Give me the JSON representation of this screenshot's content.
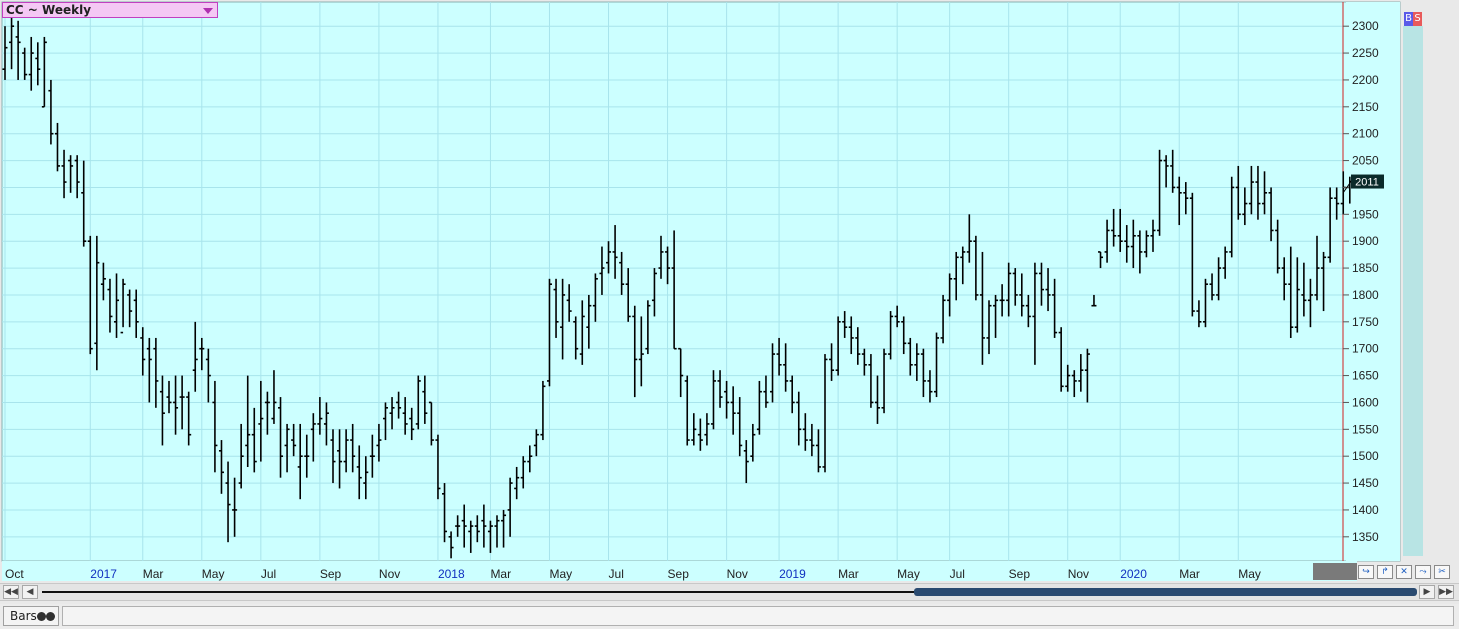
{
  "symbol": {
    "label": "CC ~ Weekly"
  },
  "price_badges": {
    "buy": "B",
    "sell": "S"
  },
  "status_bar": {
    "bars_tab_label": "Bars"
  },
  "scrollbar": {
    "left_end": "◀◀",
    "left": "◀",
    "right": "▶",
    "right_end": "▶▶"
  },
  "toolbar": {
    "buttons": [
      "↪",
      "↱",
      "✕",
      "⤳",
      "✂"
    ]
  },
  "colors": {
    "plot_bg": "#ccffff",
    "grid": "#a8e4ec",
    "bar": "#000000",
    "time_marker": "#d02020",
    "last_price_bg": "#0a2a2a"
  },
  "chart_data": {
    "type": "ohlc",
    "ylim": [
      1305,
      2345
    ],
    "yticks": [
      1350,
      1400,
      1450,
      1500,
      1550,
      1600,
      1650,
      1700,
      1750,
      1800,
      1850,
      1900,
      1950,
      2000,
      2050,
      2100,
      2150,
      2200,
      2250,
      2300
    ],
    "ytick_labels": [
      "1350",
      "1400",
      "1450",
      "1500",
      "1550",
      "1600",
      "1650",
      "1700",
      "1750",
      "1800",
      "1850",
      "1900",
      "1950",
      "",
      "2050",
      "2100",
      "2150",
      "2200",
      "2250",
      "2300"
    ],
    "last_price": "2011",
    "start_week": "2016-10-03",
    "x_labels": [
      {
        "label": "Oct",
        "week": 0,
        "year": false
      },
      {
        "label": "2017",
        "week": 13,
        "year": true
      },
      {
        "label": "Mar",
        "week": 21,
        "year": false
      },
      {
        "label": "May",
        "week": 30,
        "year": false
      },
      {
        "label": "Jul",
        "week": 39,
        "year": false
      },
      {
        "label": "Sep",
        "week": 48,
        "year": false
      },
      {
        "label": "Nov",
        "week": 57,
        "year": false
      },
      {
        "label": "2018",
        "week": 66,
        "year": true
      },
      {
        "label": "Mar",
        "week": 74,
        "year": false
      },
      {
        "label": "May",
        "week": 83,
        "year": false
      },
      {
        "label": "Jul",
        "week": 92,
        "year": false
      },
      {
        "label": "Sep",
        "week": 101,
        "year": false
      },
      {
        "label": "Nov",
        "week": 110,
        "year": false
      },
      {
        "label": "2019",
        "week": 118,
        "year": true
      },
      {
        "label": "Mar",
        "week": 127,
        "year": false
      },
      {
        "label": "May",
        "week": 136,
        "year": false
      },
      {
        "label": "Jul",
        "week": 144,
        "year": false
      },
      {
        "label": "Sep",
        "week": 153,
        "year": false
      },
      {
        "label": "Nov",
        "week": 162,
        "year": false
      },
      {
        "label": "2020",
        "week": 170,
        "year": true
      },
      {
        "label": "Mar",
        "week": 179,
        "year": false
      },
      {
        "label": "May",
        "week": 188,
        "year": false
      }
    ],
    "ohlc": [
      [
        2220,
        2300,
        2200,
        2260
      ],
      [
        2270,
        2320,
        2220,
        2300
      ],
      [
        2280,
        2310,
        2200,
        2270
      ],
      [
        2250,
        2260,
        2200,
        2210
      ],
      [
        2210,
        2280,
        2180,
        2250
      ],
      [
        2240,
        2270,
        2190,
        2220
      ],
      [
        2150,
        2280,
        2150,
        2270
      ],
      [
        2180,
        2200,
        2080,
        2100
      ],
      [
        2100,
        2120,
        2030,
        2040
      ],
      [
        2040,
        2070,
        1980,
        2010
      ],
      [
        2050,
        2060,
        1990,
        2040
      ],
      [
        2050,
        2060,
        1980,
        2010
      ],
      [
        1990,
        2050,
        1890,
        1900
      ],
      [
        1900,
        1910,
        1690,
        1700
      ],
      [
        1710,
        1910,
        1660,
        1860
      ],
      [
        1820,
        1860,
        1790,
        1830
      ],
      [
        1810,
        1830,
        1730,
        1760
      ],
      [
        1750,
        1840,
        1720,
        1790
      ],
      [
        1730,
        1830,
        1740,
        1820
      ],
      [
        1800,
        1810,
        1740,
        1770
      ],
      [
        1790,
        1810,
        1720,
        1750
      ],
      [
        1720,
        1740,
        1650,
        1680
      ],
      [
        1700,
        1720,
        1600,
        1680
      ],
      [
        1700,
        1720,
        1590,
        1640
      ],
      [
        1620,
        1650,
        1520,
        1580
      ],
      [
        1610,
        1640,
        1580,
        1600
      ],
      [
        1600,
        1650,
        1540,
        1590
      ],
      [
        1610,
        1650,
        1550,
        1610
      ],
      [
        1610,
        1620,
        1520,
        1540
      ],
      [
        1660,
        1750,
        1620,
        1680
      ],
      [
        1700,
        1720,
        1660,
        1700
      ],
      [
        1680,
        1700,
        1600,
        1650
      ],
      [
        1600,
        1640,
        1470,
        1520
      ],
      [
        1510,
        1530,
        1430,
        1470
      ],
      [
        1450,
        1490,
        1340,
        1410
      ],
      [
        1400,
        1460,
        1350,
        1400
      ],
      [
        1450,
        1560,
        1440,
        1500
      ],
      [
        1520,
        1650,
        1480,
        1540
      ],
      [
        1540,
        1590,
        1470,
        1490
      ],
      [
        1560,
        1640,
        1490,
        1570
      ],
      [
        1600,
        1620,
        1540,
        1600
      ],
      [
        1570,
        1660,
        1560,
        1600
      ],
      [
        1590,
        1610,
        1460,
        1500
      ],
      [
        1520,
        1560,
        1470,
        1550
      ],
      [
        1530,
        1560,
        1500,
        1520
      ],
      [
        1480,
        1560,
        1420,
        1500
      ],
      [
        1500,
        1540,
        1460,
        1500
      ],
      [
        1550,
        1580,
        1490,
        1560
      ],
      [
        1560,
        1610,
        1540,
        1570
      ],
      [
        1560,
        1600,
        1520,
        1580
      ],
      [
        1530,
        1550,
        1450,
        1490
      ],
      [
        1510,
        1550,
        1440,
        1490
      ],
      [
        1490,
        1550,
        1470,
        1530
      ],
      [
        1530,
        1560,
        1470,
        1500
      ],
      [
        1480,
        1520,
        1420,
        1460
      ],
      [
        1450,
        1500,
        1420,
        1470
      ],
      [
        1500,
        1540,
        1460,
        1500
      ],
      [
        1520,
        1560,
        1490,
        1530
      ],
      [
        1570,
        1600,
        1530,
        1590
      ],
      [
        1580,
        1610,
        1550,
        1590
      ],
      [
        1600,
        1620,
        1570,
        1590
      ],
      [
        1580,
        1610,
        1540,
        1560
      ],
      [
        1570,
        1590,
        1530,
        1550
      ],
      [
        1560,
        1650,
        1550,
        1640
      ],
      [
        1620,
        1650,
        1560,
        1580
      ],
      [
        1600,
        1600,
        1520,
        1530
      ],
      [
        1530,
        1540,
        1420,
        1440
      ],
      [
        1430,
        1450,
        1340,
        1360
      ],
      [
        1350,
        1360,
        1310,
        1330
      ],
      [
        1370,
        1390,
        1350,
        1370
      ],
      [
        1380,
        1410,
        1330,
        1370
      ],
      [
        1360,
        1380,
        1320,
        1370
      ],
      [
        1370,
        1390,
        1340,
        1360
      ],
      [
        1380,
        1410,
        1330,
        1370
      ],
      [
        1360,
        1380,
        1320,
        1370
      ],
      [
        1370,
        1390,
        1330,
        1380
      ],
      [
        1380,
        1400,
        1330,
        1390
      ],
      [
        1400,
        1460,
        1350,
        1450
      ],
      [
        1440,
        1480,
        1420,
        1460
      ],
      [
        1460,
        1500,
        1440,
        1490
      ],
      [
        1490,
        1520,
        1470,
        1500
      ],
      [
        1520,
        1550,
        1500,
        1540
      ],
      [
        1540,
        1640,
        1530,
        1630
      ],
      [
        1640,
        1830,
        1630,
        1820
      ],
      [
        1810,
        1830,
        1720,
        1750
      ],
      [
        1740,
        1830,
        1680,
        1800
      ],
      [
        1790,
        1820,
        1750,
        1770
      ],
      [
        1750,
        1760,
        1680,
        1700
      ],
      [
        1690,
        1790,
        1670,
        1760
      ],
      [
        1740,
        1800,
        1700,
        1780
      ],
      [
        1780,
        1840,
        1750,
        1830
      ],
      [
        1840,
        1890,
        1800,
        1850
      ],
      [
        1860,
        1900,
        1840,
        1880
      ],
      [
        1880,
        1930,
        1830,
        1870
      ],
      [
        1860,
        1880,
        1800,
        1820
      ],
      [
        1820,
        1850,
        1750,
        1760
      ],
      [
        1760,
        1780,
        1610,
        1680
      ],
      [
        1680,
        1760,
        1630,
        1690
      ],
      [
        1700,
        1790,
        1690,
        1780
      ],
      [
        1790,
        1850,
        1760,
        1840
      ],
      [
        1850,
        1910,
        1830,
        1880
      ],
      [
        1880,
        1890,
        1820,
        1850
      ],
      [
        1850,
        1920,
        1700,
        1700
      ],
      [
        1700,
        1700,
        1610,
        1650
      ],
      [
        1640,
        1650,
        1520,
        1530
      ],
      [
        1530,
        1580,
        1520,
        1550
      ],
      [
        1540,
        1570,
        1510,
        1530
      ],
      [
        1540,
        1580,
        1520,
        1560
      ],
      [
        1560,
        1660,
        1550,
        1640
      ],
      [
        1640,
        1660,
        1590,
        1610
      ],
      [
        1620,
        1640,
        1570,
        1600
      ],
      [
        1600,
        1630,
        1540,
        1580
      ],
      [
        1580,
        1610,
        1500,
        1520
      ],
      [
        1510,
        1530,
        1450,
        1490
      ],
      [
        1500,
        1560,
        1490,
        1540
      ],
      [
        1550,
        1640,
        1540,
        1620
      ],
      [
        1620,
        1650,
        1590,
        1600
      ],
      [
        1620,
        1710,
        1600,
        1690
      ],
      [
        1690,
        1720,
        1650,
        1670
      ],
      [
        1670,
        1710,
        1620,
        1640
      ],
      [
        1640,
        1650,
        1580,
        1600
      ],
      [
        1600,
        1620,
        1520,
        1550
      ],
      [
        1550,
        1580,
        1510,
        1530
      ],
      [
        1530,
        1560,
        1500,
        1520
      ],
      [
        1520,
        1550,
        1470,
        1480
      ],
      [
        1480,
        1690,
        1470,
        1680
      ],
      [
        1680,
        1710,
        1640,
        1660
      ],
      [
        1660,
        1760,
        1650,
        1750
      ],
      [
        1750,
        1770,
        1720,
        1740
      ],
      [
        1740,
        1760,
        1690,
        1720
      ],
      [
        1720,
        1740,
        1670,
        1690
      ],
      [
        1690,
        1700,
        1650,
        1670
      ],
      [
        1670,
        1690,
        1590,
        1600
      ],
      [
        1600,
        1650,
        1560,
        1590
      ],
      [
        1590,
        1700,
        1580,
        1690
      ],
      [
        1690,
        1770,
        1680,
        1760
      ],
      [
        1760,
        1780,
        1740,
        1750
      ],
      [
        1750,
        1760,
        1690,
        1710
      ],
      [
        1710,
        1720,
        1650,
        1670
      ],
      [
        1670,
        1710,
        1640,
        1690
      ],
      [
        1690,
        1700,
        1610,
        1640
      ],
      [
        1640,
        1660,
        1600,
        1620
      ],
      [
        1620,
        1730,
        1610,
        1720
      ],
      [
        1720,
        1800,
        1710,
        1790
      ],
      [
        1790,
        1840,
        1760,
        1830
      ],
      [
        1830,
        1880,
        1790,
        1870
      ],
      [
        1870,
        1890,
        1820,
        1880
      ],
      [
        1880,
        1950,
        1860,
        1900
      ],
      [
        1900,
        1910,
        1790,
        1800
      ],
      [
        1800,
        1880,
        1670,
        1720
      ],
      [
        1720,
        1790,
        1690,
        1780
      ],
      [
        1780,
        1800,
        1720,
        1790
      ],
      [
        1790,
        1820,
        1760,
        1790
      ],
      [
        1790,
        1860,
        1760,
        1840
      ],
      [
        1840,
        1850,
        1780,
        1800
      ],
      [
        1800,
        1840,
        1760,
        1780
      ],
      [
        1780,
        1800,
        1740,
        1760
      ],
      [
        1760,
        1860,
        1670,
        1840
      ],
      [
        1840,
        1860,
        1780,
        1810
      ],
      [
        1810,
        1850,
        1770,
        1800
      ],
      [
        1800,
        1830,
        1720,
        1730
      ],
      [
        1730,
        1740,
        1620,
        1630
      ],
      [
        1630,
        1670,
        1620,
        1650
      ],
      [
        1650,
        1660,
        1610,
        1640
      ],
      [
        1640,
        1690,
        1620,
        1660
      ],
      [
        1660,
        1700,
        1600,
        1690
      ],
      [
        1780,
        1800,
        1780,
        1780
      ],
      [
        1880,
        1880,
        1850,
        1870
      ],
      [
        1880,
        1940,
        1860,
        1920
      ],
      [
        1920,
        1960,
        1890,
        1910
      ],
      [
        1910,
        1960,
        1880,
        1900
      ],
      [
        1900,
        1930,
        1860,
        1890
      ],
      [
        1890,
        1940,
        1850,
        1910
      ],
      [
        1910,
        1920,
        1840,
        1880
      ],
      [
        1880,
        1920,
        1870,
        1910
      ],
      [
        1910,
        1940,
        1880,
        1920
      ],
      [
        1920,
        2070,
        1910,
        2050
      ],
      [
        2050,
        2060,
        2000,
        2040
      ],
      [
        2040,
        2070,
        1990,
        2000
      ],
      [
        2000,
        2020,
        1930,
        1990
      ],
      [
        1990,
        2010,
        1950,
        1980
      ],
      [
        1980,
        1990,
        1760,
        1770
      ],
      [
        1770,
        1790,
        1740,
        1750
      ],
      [
        1750,
        1830,
        1740,
        1820
      ],
      [
        1820,
        1840,
        1790,
        1800
      ],
      [
        1800,
        1870,
        1790,
        1850
      ],
      [
        1850,
        1890,
        1830,
        1880
      ],
      [
        1880,
        2020,
        1870,
        2000
      ],
      [
        2000,
        2040,
        1940,
        1950
      ],
      [
        1950,
        2000,
        1930,
        1970
      ],
      [
        1970,
        2040,
        1950,
        2010
      ],
      [
        2010,
        2040,
        1940,
        1970
      ],
      [
        1970,
        2030,
        1950,
        1990
      ],
      [
        1990,
        2000,
        1900,
        1920
      ],
      [
        1920,
        1940,
        1840,
        1850
      ],
      [
        1850,
        1870,
        1790,
        1820
      ],
      [
        1820,
        1890,
        1720,
        1740
      ],
      [
        1740,
        1870,
        1730,
        1810
      ],
      [
        1800,
        1860,
        1760,
        1790
      ],
      [
        1790,
        1830,
        1740,
        1800
      ],
      [
        1800,
        1910,
        1790,
        1850
      ],
      [
        1850,
        1880,
        1770,
        1870
      ],
      [
        1870,
        2000,
        1860,
        1980
      ],
      [
        1980,
        2000,
        1940,
        1970
      ],
      [
        1970,
        2030,
        1950,
        2000
      ],
      [
        2000,
        2020,
        1970,
        2011
      ]
    ]
  }
}
